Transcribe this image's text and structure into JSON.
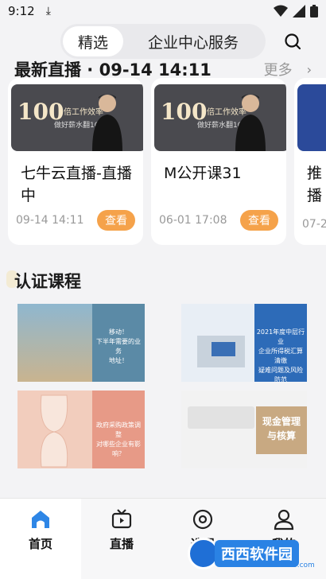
{
  "status_bar": {
    "time": "9:12"
  },
  "top_nav": {
    "tabs": [
      {
        "label": "精选"
      },
      {
        "label": "企业中心服务"
      }
    ]
  },
  "live": {
    "title": "最新直播 · 09-14 14:11",
    "more_label": "更多",
    "more_arrow": "›",
    "cards": [
      {
        "title": "七牛云直播-直播中",
        "time": "09-14 14:11",
        "button": "查看",
        "thumb_big": "100",
        "thumb_slogan": "倍工作效率",
        "thumb_sub": "做好薪水翻10倍"
      },
      {
        "title": "M公开课31",
        "time": "06-01 17:08",
        "button": "查看",
        "thumb_big": "100",
        "thumb_slogan": "倍工作效率",
        "thumb_sub": "做好薪水翻10倍"
      },
      {
        "title": "推播",
        "time": "07-2"
      }
    ]
  },
  "cert": {
    "title": "认证课程",
    "courses": [
      {
        "text": "移动！\n下半年需要的业务\n地址！"
      },
      {
        "text": "2021年度中层行业\n企业所得税汇算清缴\n疑难问题及风险防范"
      },
      {
        "text": "政府采购政策调整\n对哪些企业有影响？"
      },
      {
        "text": "现金管理\n与核算"
      }
    ]
  },
  "bottom_nav": {
    "items": [
      {
        "label": "首页"
      },
      {
        "label": "直播"
      },
      {
        "label": "选课"
      },
      {
        "label": "我的"
      }
    ]
  },
  "watermark": {
    "text": "西西软件园",
    "url": "CR173.com"
  },
  "colors": {
    "accent": "#f5a24a",
    "home_icon": "#2e86e6"
  }
}
